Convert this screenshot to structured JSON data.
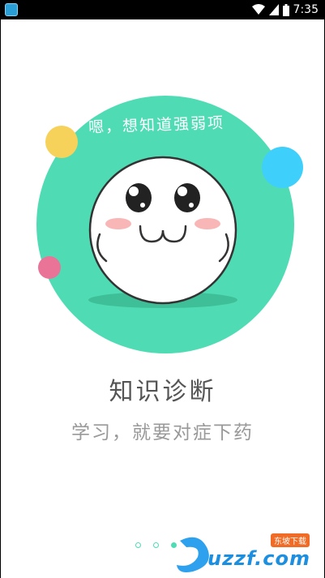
{
  "status_bar": {
    "time": "7:35",
    "icons": [
      "app-notification-icon",
      "wifi-icon",
      "signal-icon",
      "battery-icon"
    ]
  },
  "intro": {
    "bubble_caption": "嗯，想知道强弱项",
    "title": "知识诊断",
    "subtitle": "学习，就要对症下药"
  },
  "pager": {
    "count": 3,
    "active_index": 2
  },
  "watermark": {
    "brand": "uzzf.com",
    "tag": "东坡下载"
  },
  "colors": {
    "accent_green": "#4fdcb5",
    "dot_yellow": "#f7d25a",
    "dot_blue": "#3fcffb",
    "dot_pink": "#ea7498"
  }
}
